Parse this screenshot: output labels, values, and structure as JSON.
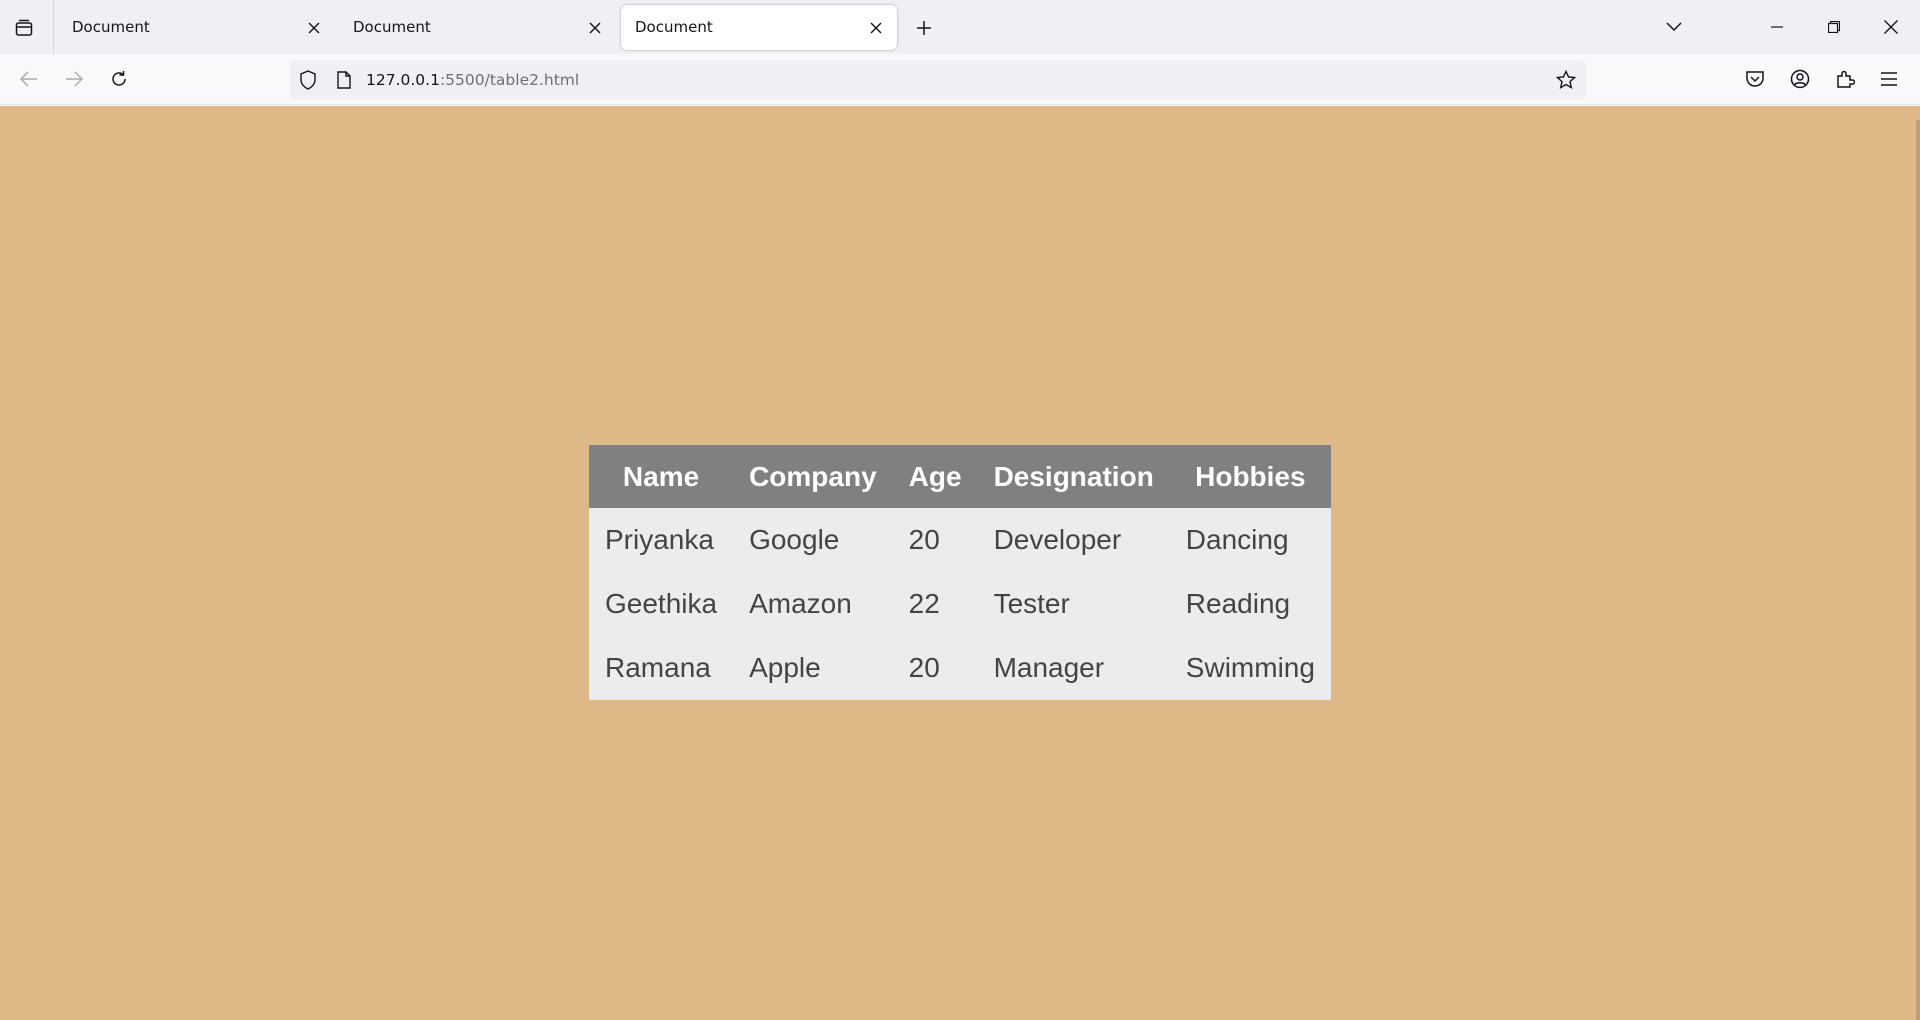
{
  "browser": {
    "tabs": [
      {
        "title": "Document",
        "active": false
      },
      {
        "title": "Document",
        "active": false
      },
      {
        "title": "Document",
        "active": true
      }
    ],
    "url_host": "127.0.0.1",
    "url_rest": ":5500/table2.html"
  },
  "page": {
    "background_color": "#deb887",
    "table": {
      "headers": [
        "Name",
        "Company",
        "Age",
        "Designation",
        "Hobbies"
      ],
      "rows": [
        [
          "Priyanka",
          "Google",
          "20",
          "Developer",
          "Dancing"
        ],
        [
          "Geethika",
          "Amazon",
          "22",
          "Tester",
          "Reading"
        ],
        [
          "Ramana",
          "Apple",
          "20",
          "Manager",
          "Swimming"
        ]
      ],
      "header_color": "#808080",
      "row_color": "#ececec"
    }
  }
}
